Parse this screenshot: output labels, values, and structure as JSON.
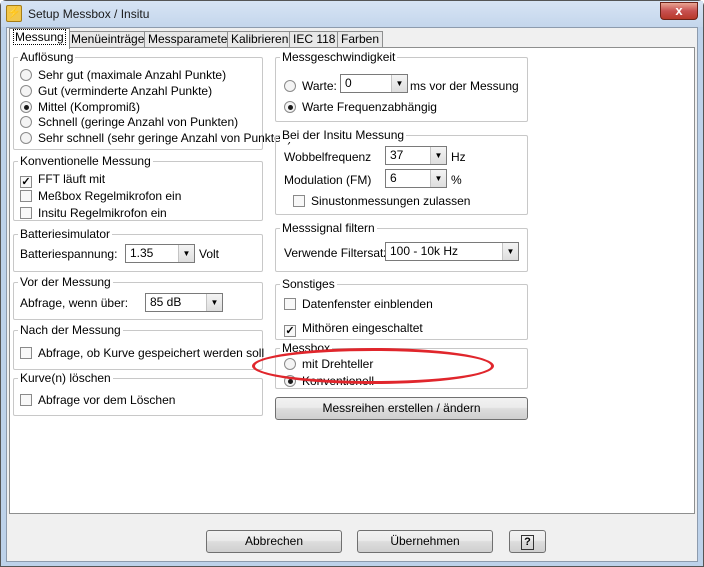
{
  "window": {
    "title": "Setup Messbox / Insitu",
    "close_glyph": "x"
  },
  "tabs": [
    "Messung",
    "Menüeinträge",
    "Messparameter",
    "Kalibrieren",
    "IEC 118",
    "Farben"
  ],
  "aufloesung": {
    "title": "Auflösung",
    "options": [
      "Sehr gut (maximale Anzahl Punkte)",
      "Gut (verminderte Anzahl Punkte)",
      "Mittel (Kompromiß)",
      "Schnell (geringe Anzahl von Punkten)",
      "Sehr schnell (sehr geringe Anzahl von Punkten)"
    ],
    "selected": "Mittel (Kompromiß)"
  },
  "konventionell": {
    "title": "Konventionelle Messung",
    "items": [
      {
        "label": "FFT läuft mit",
        "checked": true
      },
      {
        "label": "Meßbox Regelmikrofon ein",
        "checked": false
      },
      {
        "label": "Insitu Regelmikrofon ein",
        "checked": false
      }
    ]
  },
  "batterie": {
    "title": "Batteriesimulator",
    "label": "Batteriespannung:",
    "value": "1.35",
    "unit": "Volt"
  },
  "vor": {
    "title": "Vor der Messung",
    "label": "Abfrage, wenn über:",
    "value": "85 dB"
  },
  "nach": {
    "title": "Nach der Messung",
    "label": "Abfrage, ob Kurve gespeichert werden soll",
    "checked": false
  },
  "kurve": {
    "title": "Kurve(n) löschen",
    "label": "Abfrage vor dem Löschen",
    "checked": false
  },
  "geschw": {
    "title": "Messgeschwindigkeit",
    "warte_label": "Warte:",
    "warte_value": "0",
    "warte_suffix": "ms vor der Messung",
    "freq_label": "Warte Frequenzabhängig",
    "selected": "Warte Frequenzabhängig"
  },
  "insitu": {
    "title": "Bei der Insitu Messung",
    "wobbel_label": "Wobbelfrequenz",
    "wobbel_value": "37",
    "wobbel_unit": "Hz",
    "mod_label": "Modulation (FM)",
    "mod_value": "6",
    "mod_unit": "%",
    "sinus_label": "Sinustonmessungen zulassen",
    "sinus_checked": false
  },
  "filter": {
    "title": "Messsignal filtern",
    "label": "Verwende Filtersatz:",
    "value": "100 - 10k Hz"
  },
  "sonstiges": {
    "title": "Sonstiges",
    "items": [
      {
        "label": "Datenfenster einblenden",
        "checked": false
      },
      {
        "label": "Mithören eingeschaltet",
        "checked": true
      }
    ]
  },
  "messbox": {
    "title": "Messbox",
    "options": [
      "mit Drehteller",
      "Konventionell"
    ],
    "selected": "Konventionell"
  },
  "buttons": {
    "messreihen": "Messreihen erstellen / ändern",
    "cancel": "Abbrechen",
    "apply": "Übernehmen",
    "help": "?"
  },
  "colors": {
    "highlight": "#e0262c"
  }
}
